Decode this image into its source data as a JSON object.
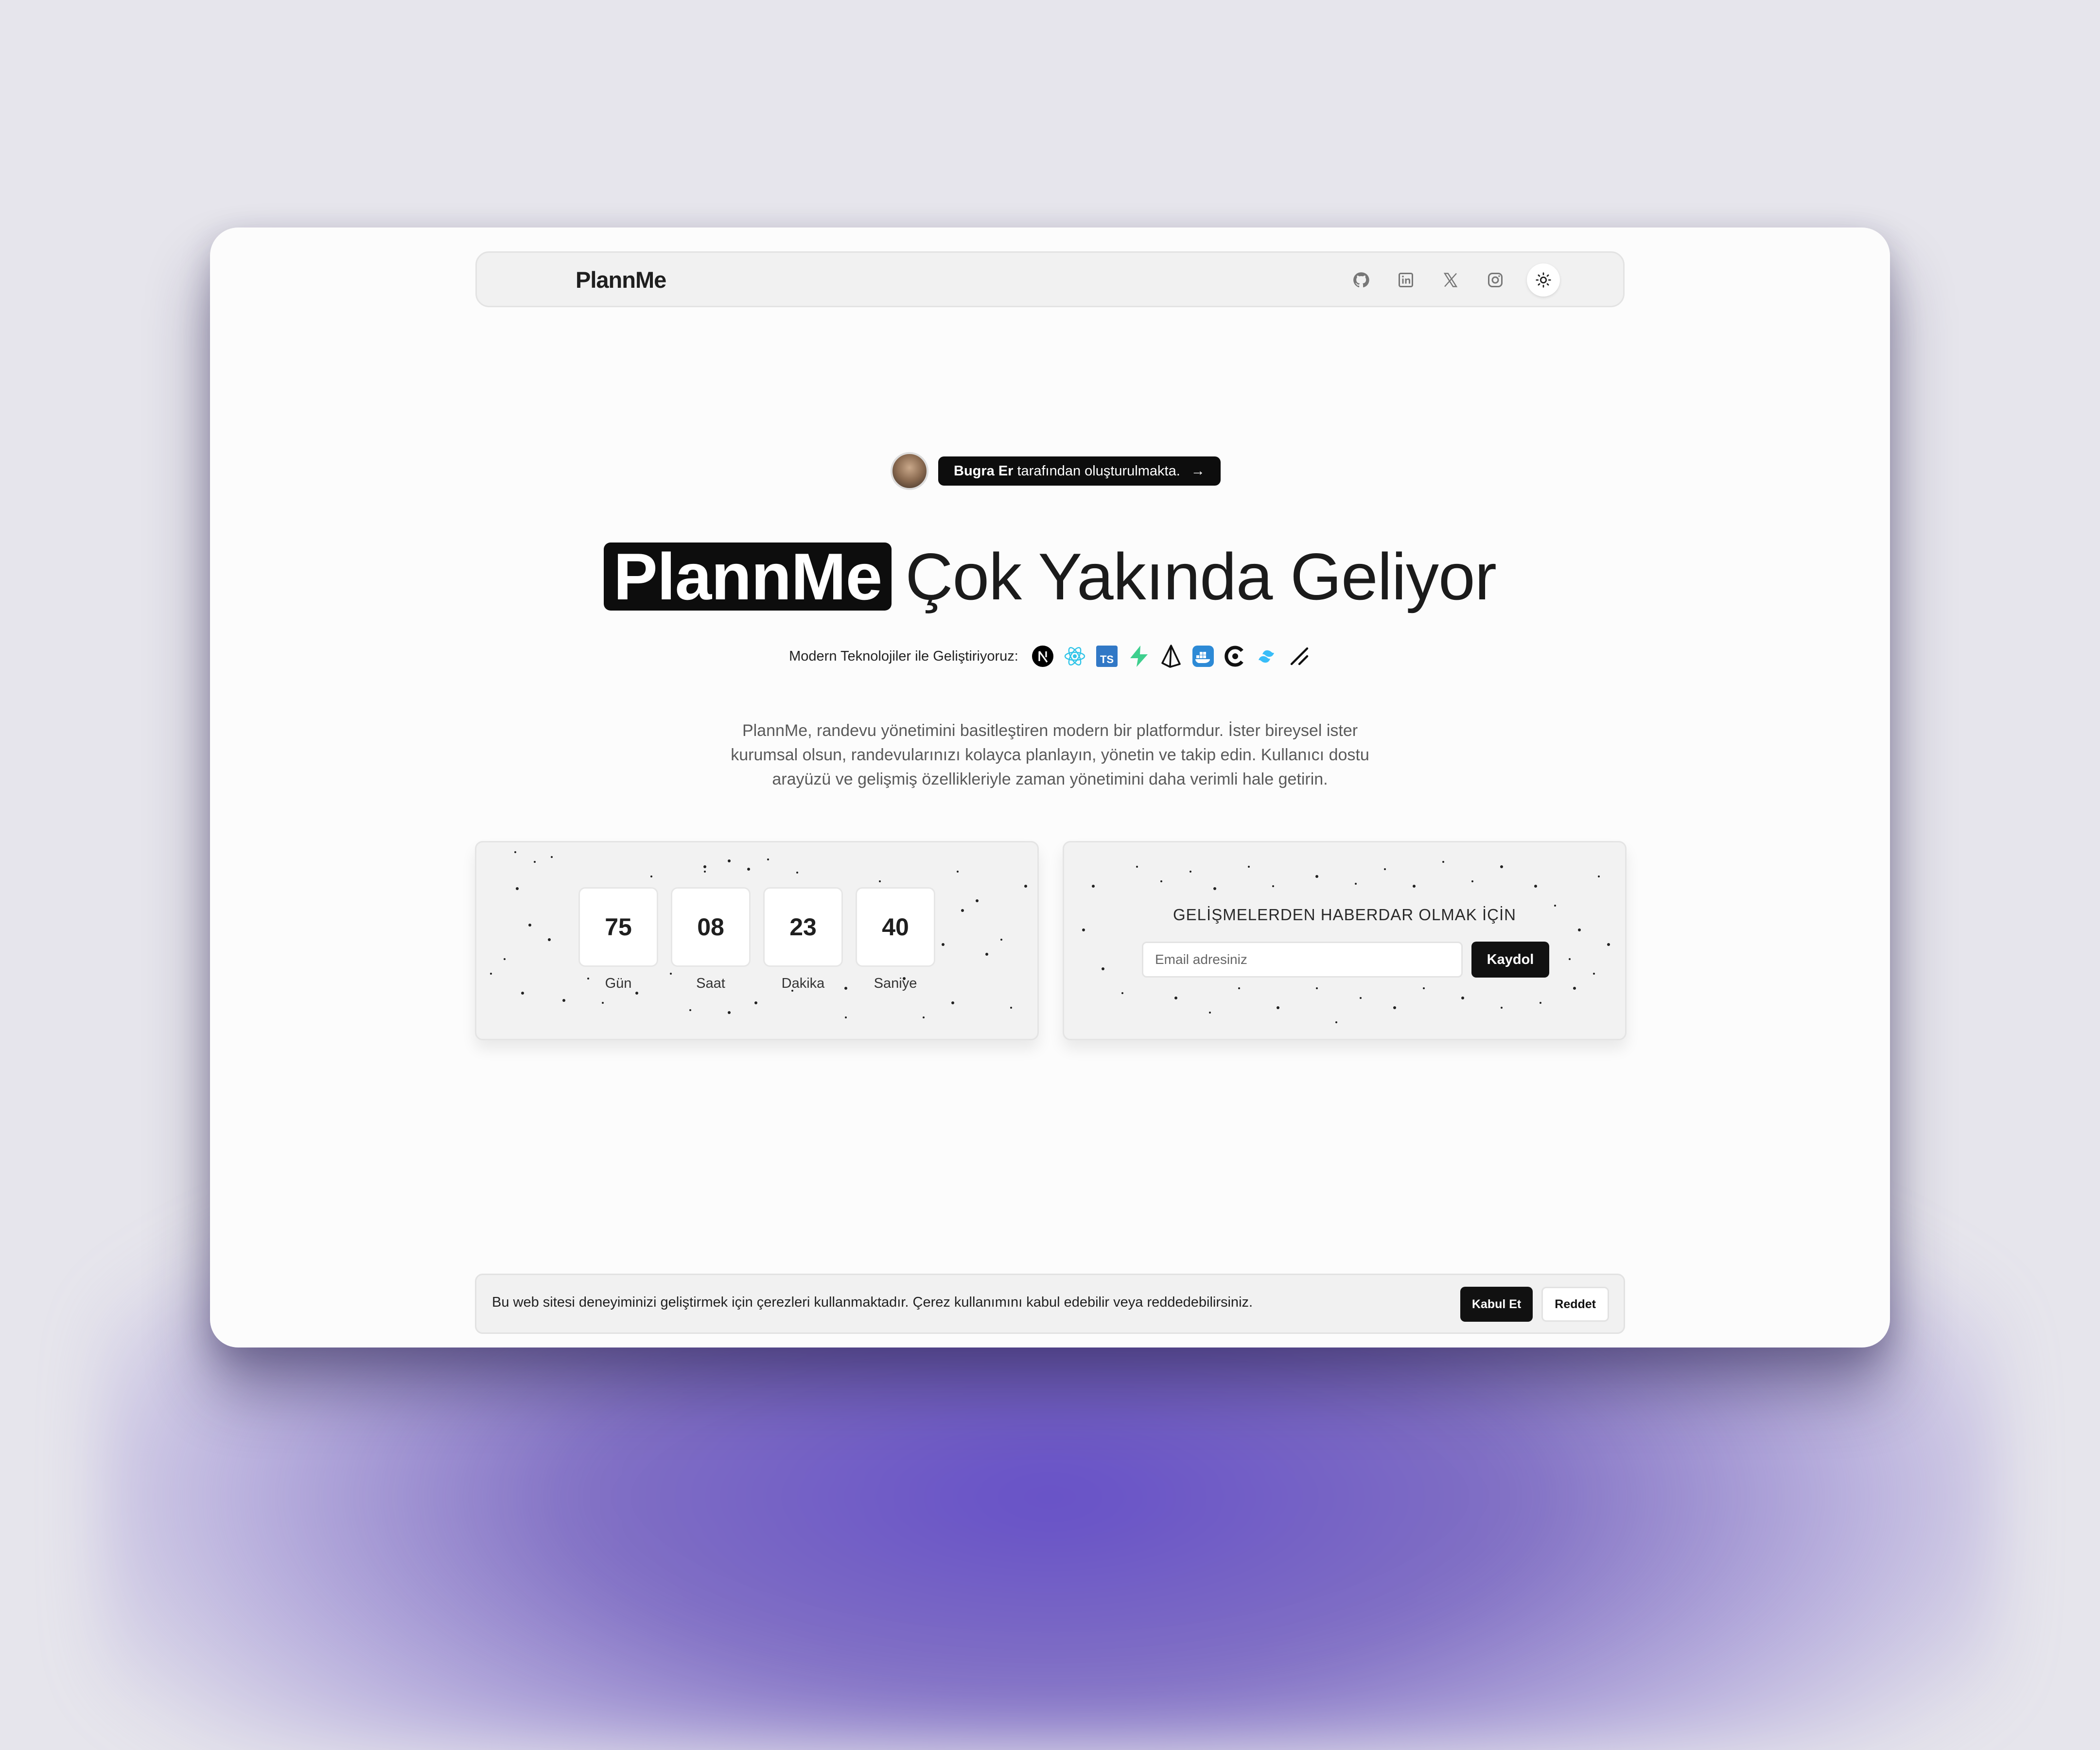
{
  "nav": {
    "brand": "PlannMe",
    "icons": [
      "github-icon",
      "linkedin-icon",
      "x-icon",
      "instagram-icon"
    ],
    "theme_toggle_icon": "sun-icon"
  },
  "author": {
    "name": "Bugra Er",
    "text": "tarafından oluşturulmakta.",
    "arrow": "→"
  },
  "headline": {
    "highlight": "PlannMe",
    "rest": "Çok Yakında Geliyor"
  },
  "tech": {
    "label": "Modern Teknolojiler ile Geliştiriyoruz:",
    "icons": [
      "nextjs-icon",
      "react-icon",
      "typescript-icon",
      "supabase-icon",
      "prisma-icon",
      "docker-icon",
      "codegen-icon",
      "tailwind-icon",
      "shadcn-icon"
    ]
  },
  "description": "PlannMe, randevu yönetimini basitleştiren modern bir platformdur. İster bireysel ister kurumsal olsun, randevularınızı kolayca planlayın, yönetin ve takip edin. Kullanıcı dostu arayüzü ve gelişmiş özellikleriyle zaman yönetimini daha verimli hale getirin.",
  "countdown": {
    "days": "75",
    "hours": "08",
    "minutes": "23",
    "seconds": "40",
    "days_label": "Gün",
    "hours_label": "Saat",
    "minutes_label": "Dakika",
    "seconds_label": "Saniye"
  },
  "newsletter": {
    "title": "GELİŞMELERDEN HABERDAR OLMAK İÇİN",
    "placeholder": "Email adresiniz",
    "button": "Kaydol"
  },
  "cookie": {
    "text": "Bu web sitesi deneyiminizi geliştirmek için çerezleri kullanmaktadır. Çerez kullanımını kabul edebilir veya reddedebilirsiniz.",
    "accept": "Kabul Et",
    "reject": "Reddet"
  },
  "colors": {
    "background": "#e6e5ec",
    "accent_dark": "#0d0d0d",
    "glow": "#6650c8"
  }
}
